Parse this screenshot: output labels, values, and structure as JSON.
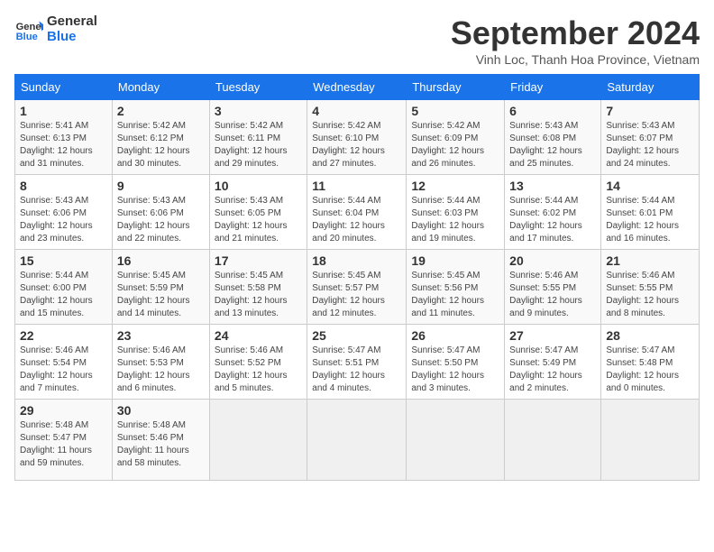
{
  "logo": {
    "line1": "General",
    "line2": "Blue"
  },
  "title": "September 2024",
  "subtitle": "Vinh Loc, Thanh Hoa Province, Vietnam",
  "days_header": [
    "Sunday",
    "Monday",
    "Tuesday",
    "Wednesday",
    "Thursday",
    "Friday",
    "Saturday"
  ],
  "weeks": [
    [
      {
        "day": "1",
        "sunrise": "5:41 AM",
        "sunset": "6:13 PM",
        "daylight": "12 hours and 31 minutes."
      },
      {
        "day": "2",
        "sunrise": "5:42 AM",
        "sunset": "6:12 PM",
        "daylight": "12 hours and 30 minutes."
      },
      {
        "day": "3",
        "sunrise": "5:42 AM",
        "sunset": "6:11 PM",
        "daylight": "12 hours and 29 minutes."
      },
      {
        "day": "4",
        "sunrise": "5:42 AM",
        "sunset": "6:10 PM",
        "daylight": "12 hours and 27 minutes."
      },
      {
        "day": "5",
        "sunrise": "5:42 AM",
        "sunset": "6:09 PM",
        "daylight": "12 hours and 26 minutes."
      },
      {
        "day": "6",
        "sunrise": "5:43 AM",
        "sunset": "6:08 PM",
        "daylight": "12 hours and 25 minutes."
      },
      {
        "day": "7",
        "sunrise": "5:43 AM",
        "sunset": "6:07 PM",
        "daylight": "12 hours and 24 minutes."
      }
    ],
    [
      {
        "day": "8",
        "sunrise": "5:43 AM",
        "sunset": "6:06 PM",
        "daylight": "12 hours and 23 minutes."
      },
      {
        "day": "9",
        "sunrise": "5:43 AM",
        "sunset": "6:06 PM",
        "daylight": "12 hours and 22 minutes."
      },
      {
        "day": "10",
        "sunrise": "5:43 AM",
        "sunset": "6:05 PM",
        "daylight": "12 hours and 21 minutes."
      },
      {
        "day": "11",
        "sunrise": "5:44 AM",
        "sunset": "6:04 PM",
        "daylight": "12 hours and 20 minutes."
      },
      {
        "day": "12",
        "sunrise": "5:44 AM",
        "sunset": "6:03 PM",
        "daylight": "12 hours and 19 minutes."
      },
      {
        "day": "13",
        "sunrise": "5:44 AM",
        "sunset": "6:02 PM",
        "daylight": "12 hours and 17 minutes."
      },
      {
        "day": "14",
        "sunrise": "5:44 AM",
        "sunset": "6:01 PM",
        "daylight": "12 hours and 16 minutes."
      }
    ],
    [
      {
        "day": "15",
        "sunrise": "5:44 AM",
        "sunset": "6:00 PM",
        "daylight": "12 hours and 15 minutes."
      },
      {
        "day": "16",
        "sunrise": "5:45 AM",
        "sunset": "5:59 PM",
        "daylight": "12 hours and 14 minutes."
      },
      {
        "day": "17",
        "sunrise": "5:45 AM",
        "sunset": "5:58 PM",
        "daylight": "12 hours and 13 minutes."
      },
      {
        "day": "18",
        "sunrise": "5:45 AM",
        "sunset": "5:57 PM",
        "daylight": "12 hours and 12 minutes."
      },
      {
        "day": "19",
        "sunrise": "5:45 AM",
        "sunset": "5:56 PM",
        "daylight": "12 hours and 11 minutes."
      },
      {
        "day": "20",
        "sunrise": "5:46 AM",
        "sunset": "5:55 PM",
        "daylight": "12 hours and 9 minutes."
      },
      {
        "day": "21",
        "sunrise": "5:46 AM",
        "sunset": "5:55 PM",
        "daylight": "12 hours and 8 minutes."
      }
    ],
    [
      {
        "day": "22",
        "sunrise": "5:46 AM",
        "sunset": "5:54 PM",
        "daylight": "12 hours and 7 minutes."
      },
      {
        "day": "23",
        "sunrise": "5:46 AM",
        "sunset": "5:53 PM",
        "daylight": "12 hours and 6 minutes."
      },
      {
        "day": "24",
        "sunrise": "5:46 AM",
        "sunset": "5:52 PM",
        "daylight": "12 hours and 5 minutes."
      },
      {
        "day": "25",
        "sunrise": "5:47 AM",
        "sunset": "5:51 PM",
        "daylight": "12 hours and 4 minutes."
      },
      {
        "day": "26",
        "sunrise": "5:47 AM",
        "sunset": "5:50 PM",
        "daylight": "12 hours and 3 minutes."
      },
      {
        "day": "27",
        "sunrise": "5:47 AM",
        "sunset": "5:49 PM",
        "daylight": "12 hours and 2 minutes."
      },
      {
        "day": "28",
        "sunrise": "5:47 AM",
        "sunset": "5:48 PM",
        "daylight": "12 hours and 0 minutes."
      }
    ],
    [
      {
        "day": "29",
        "sunrise": "5:48 AM",
        "sunset": "5:47 PM",
        "daylight": "11 hours and 59 minutes."
      },
      {
        "day": "30",
        "sunrise": "5:48 AM",
        "sunset": "5:46 PM",
        "daylight": "11 hours and 58 minutes."
      },
      null,
      null,
      null,
      null,
      null
    ]
  ]
}
